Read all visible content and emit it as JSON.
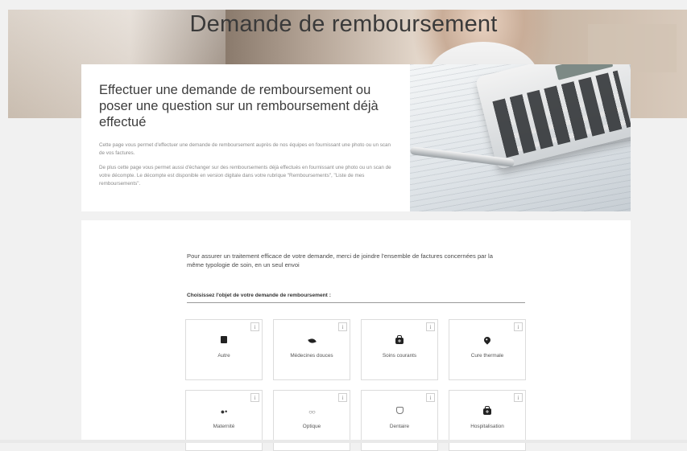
{
  "hero": {
    "title": "Demande de remboursement"
  },
  "intro": {
    "heading": "Effectuer une demande de remboursement ou poser une question sur un remboursement déjà effectué",
    "paragraph1": "Cette page vous permet d'effectuer une demande de remboursement auprès de nos équipes en fournissant une photo ou un scan de vos factures.",
    "paragraph2": "De plus cette page vous permet aussi d'échanger sur des remboursements déjà effectués en fournissant une photo ou un scan de votre décompte. Le décompte est disponible en version digitale dans votre rubrique \"Remboursements\", \"Liste de mes remboursements\"."
  },
  "form": {
    "notice": "Pour assurer un traitement efficace de votre demande, merci de joindre l'ensemble de factures concernées par la même typologie de soin, en un seul envoi",
    "choose_label": "Choisissez l'objet de votre demande de remboursement :"
  },
  "tiles": [
    {
      "label": "Autre",
      "icon": "document-icon",
      "info": "i"
    },
    {
      "label": "Médecines douces",
      "icon": "leaf-icon",
      "info": "i"
    },
    {
      "label": "Soins courants",
      "icon": "medical-bag-icon",
      "info": "i"
    },
    {
      "label": "Cure thermale",
      "icon": "map-pin-icon",
      "info": "i"
    },
    {
      "label": "Maternité",
      "icon": "family-icon",
      "info": "i"
    },
    {
      "label": "Optique",
      "icon": "glasses-icon",
      "info": "i"
    },
    {
      "label": "Dentaire",
      "icon": "tooth-icon",
      "info": "i"
    },
    {
      "label": "Hospitalisation",
      "icon": "medical-bag-icon",
      "info": "i"
    }
  ]
}
